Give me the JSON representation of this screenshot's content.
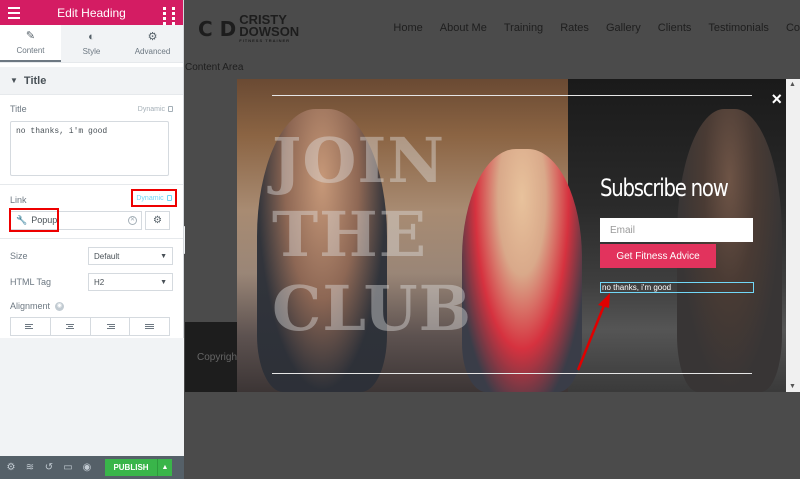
{
  "panel": {
    "header_title": "Edit Heading",
    "tabs": [
      {
        "label": "Content",
        "icon": "pencil-icon"
      },
      {
        "label": "Style",
        "icon": "half-circle-icon"
      },
      {
        "label": "Advanced",
        "icon": "gear-icon"
      }
    ],
    "section_title": "Title",
    "title_label": "Title",
    "dynamic_label": "Dynamic",
    "title_value": "no thanks, i'm good",
    "link_label": "Link",
    "link_dynamic_label": "Dynamic",
    "link_value": "Popup",
    "size_label": "Size",
    "size_value": "Default",
    "html_tag_label": "HTML Tag",
    "html_tag_value": "H2",
    "alignment_label": "Alignment",
    "publish_label": "PUBLISH"
  },
  "site": {
    "logo_line1": "CRISTY",
    "logo_line2": "DOWSON",
    "logo_tagline": "FITNESS TRAINER",
    "nav": [
      "Home",
      "About Me",
      "Training",
      "Rates",
      "Gallery",
      "Clients",
      "Testimonials",
      "Co"
    ],
    "content_area": "Content Area",
    "copyright": "Copyrigh"
  },
  "popup": {
    "join_line1": "JOIN",
    "join_line2": "THE",
    "join_line3": "CLUB",
    "heading": "Subscribe now",
    "email_placeholder": "Email",
    "cta_label": "Get Fitness Advice",
    "no_thanks": "no thanks, i'm good",
    "close_symbol": "×"
  },
  "colors": {
    "brand": "#d41c63",
    "cta": "#e2335d",
    "publish": "#39b54a",
    "highlight": "#e00000",
    "focus": "#71d7f7"
  }
}
